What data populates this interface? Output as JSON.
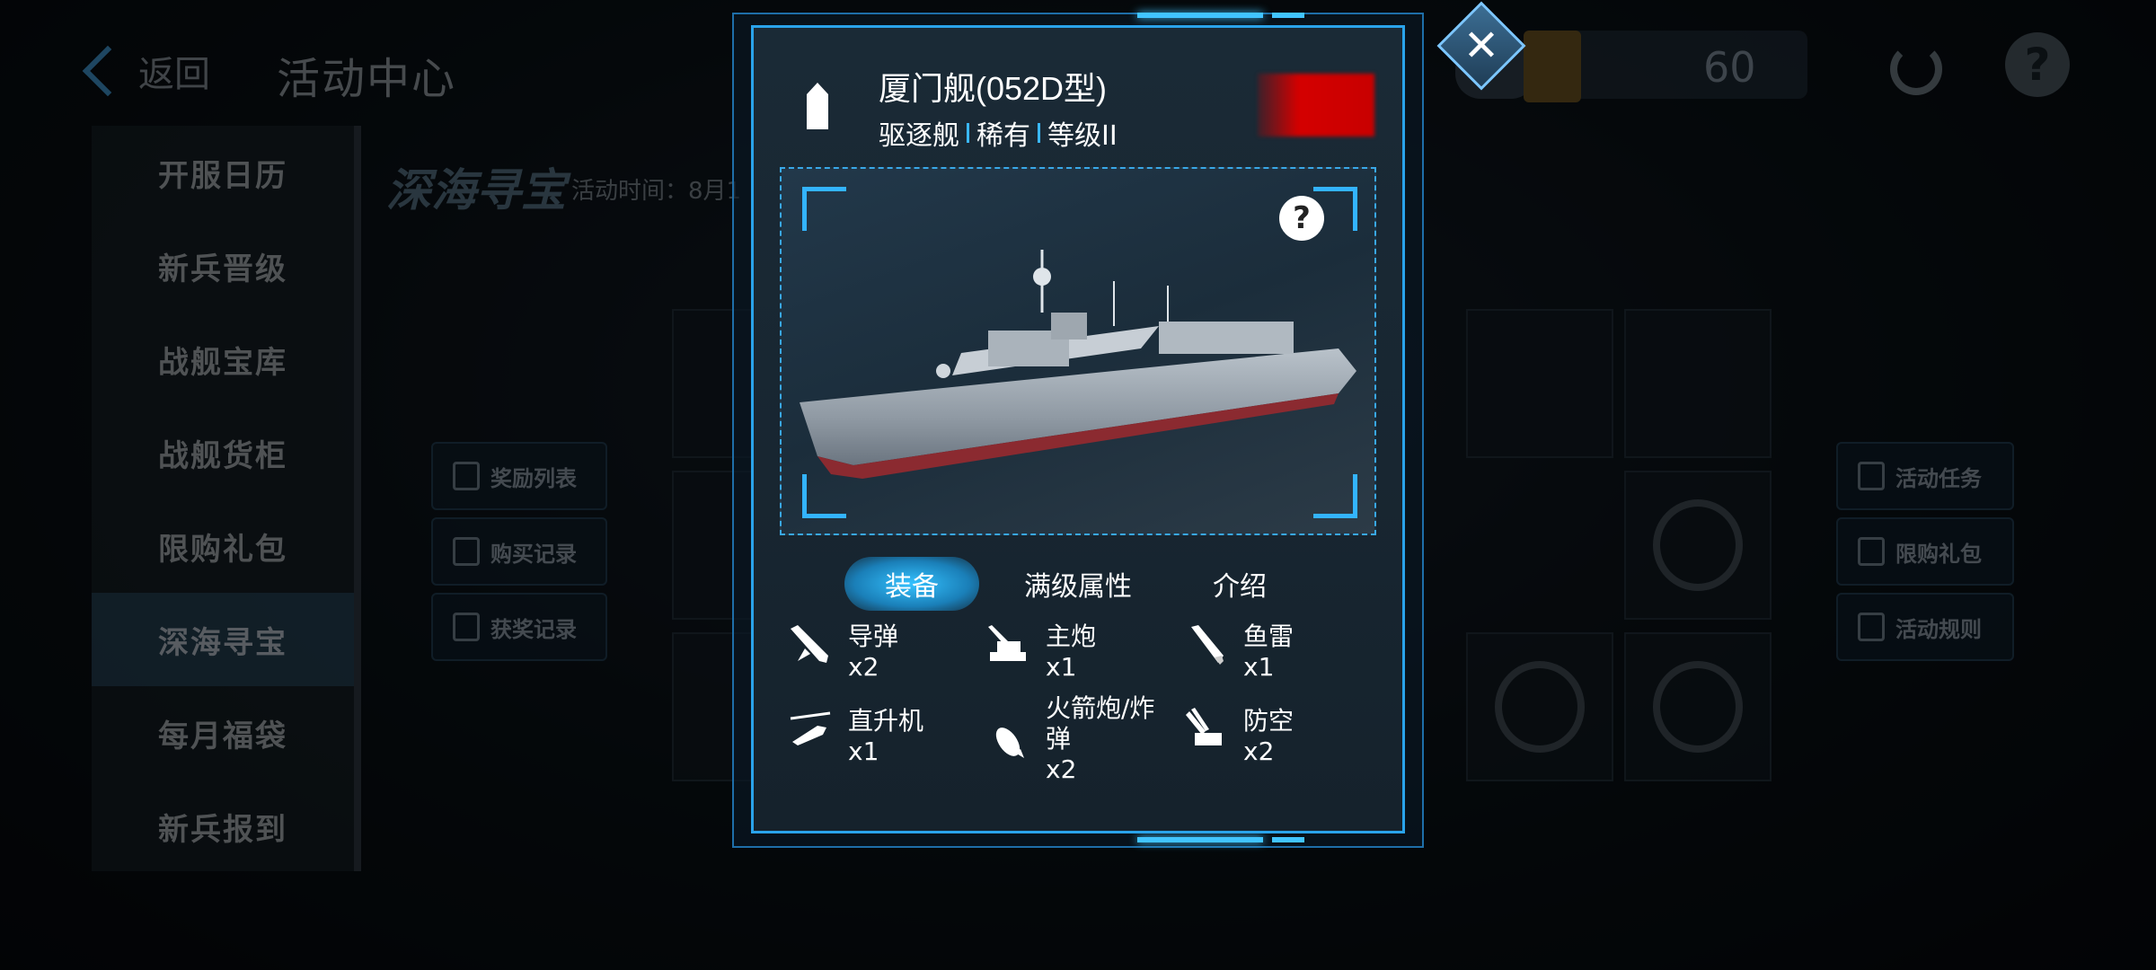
{
  "header": {
    "back_label": "返回",
    "title": "活动中心",
    "resource_value": "60"
  },
  "sidebar": {
    "items": [
      {
        "label": "开服日历"
      },
      {
        "label": "新兵晋级"
      },
      {
        "label": "战舰宝库"
      },
      {
        "label": "战舰货柜"
      },
      {
        "label": "限购礼包"
      },
      {
        "label": "深海寻宝"
      },
      {
        "label": "每月福袋"
      },
      {
        "label": "新兵报到"
      }
    ],
    "active_index": 5
  },
  "main": {
    "section_title": "深海寻宝",
    "activity_time": "活动时间：8月1",
    "left_buttons": [
      {
        "label": "奖励列表"
      },
      {
        "label": "购买记录"
      },
      {
        "label": "获奖记录"
      }
    ],
    "right_buttons": [
      {
        "label": "活动任务"
      },
      {
        "label": "限购礼包"
      },
      {
        "label": "活动规则"
      }
    ]
  },
  "modal": {
    "close_icon": "close-icon",
    "ship_name": "厦门舰(052D型)",
    "ship_class": "驱逐舰",
    "rarity": "稀有",
    "level": "等级II",
    "tabs": [
      {
        "label": "装备",
        "active": true
      },
      {
        "label": "满级属性",
        "active": false
      },
      {
        "label": "介绍",
        "active": false
      }
    ],
    "equipment": [
      {
        "name": "导弹",
        "count": "x2",
        "icon": "missile-icon"
      },
      {
        "name": "主炮",
        "count": "x1",
        "icon": "main-gun-icon"
      },
      {
        "name": "鱼雷",
        "count": "x1",
        "icon": "torpedo-icon"
      },
      {
        "name": "直升机",
        "count": "x1",
        "icon": "helicopter-icon"
      },
      {
        "name": "火箭炮/炸弹",
        "count": "x2",
        "icon": "rocket-bomb-icon"
      },
      {
        "name": "防空",
        "count": "x2",
        "icon": "anti-air-icon"
      }
    ]
  },
  "colors": {
    "accent": "#2aa3ea",
    "tab_active": "#35c2ff",
    "flag": "#d40000"
  }
}
